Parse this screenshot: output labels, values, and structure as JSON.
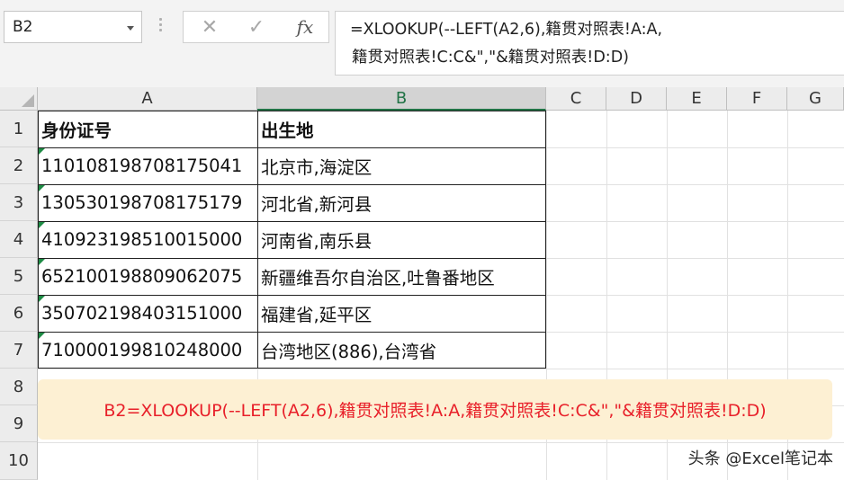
{
  "name_box": {
    "value": "B2"
  },
  "formula_bar": {
    "cancel_glyph": "✕",
    "enter_glyph": "✓",
    "function_glyph": "fx",
    "formula_line1": "=XLOOKUP(--LEFT(A2,6),籍贯对照表!A:A,",
    "formula_line2": "籍贯对照表!C:C&\",\"&籍贯对照表!D:D)"
  },
  "columns": [
    "A",
    "B",
    "C",
    "D",
    "E",
    "F",
    "G"
  ],
  "rows": [
    "1",
    "2",
    "3",
    "4",
    "5",
    "6",
    "7",
    "8",
    "9",
    "10"
  ],
  "table": {
    "headers": [
      "身份证号",
      "出生地"
    ],
    "rows": [
      [
        "110108198708175041",
        "北京市,海淀区"
      ],
      [
        "130530198708175179",
        "河北省,新河县"
      ],
      [
        "410923198510015000",
        "河南省,南乐县"
      ],
      [
        "652100198809062075",
        "新疆维吾尔自治区,吐鲁番地区"
      ],
      [
        "350702198403151000",
        "福建省,延平区"
      ],
      [
        "710000199810248000",
        "台湾地区(886),台湾省"
      ]
    ]
  },
  "note": {
    "text": "B2=XLOOKUP(--LEFT(A2,6),籍贯对照表!A:A,籍贯对照表!C:C&\",\"&籍贯对照表!D:D)"
  },
  "watermark": {
    "text": "头条 @Excel笔记本"
  },
  "colors": {
    "accent": "#217346",
    "note_bg": "#fdf0d3",
    "note_text": "#e8202a",
    "error_indicator": "#1e8c45"
  }
}
